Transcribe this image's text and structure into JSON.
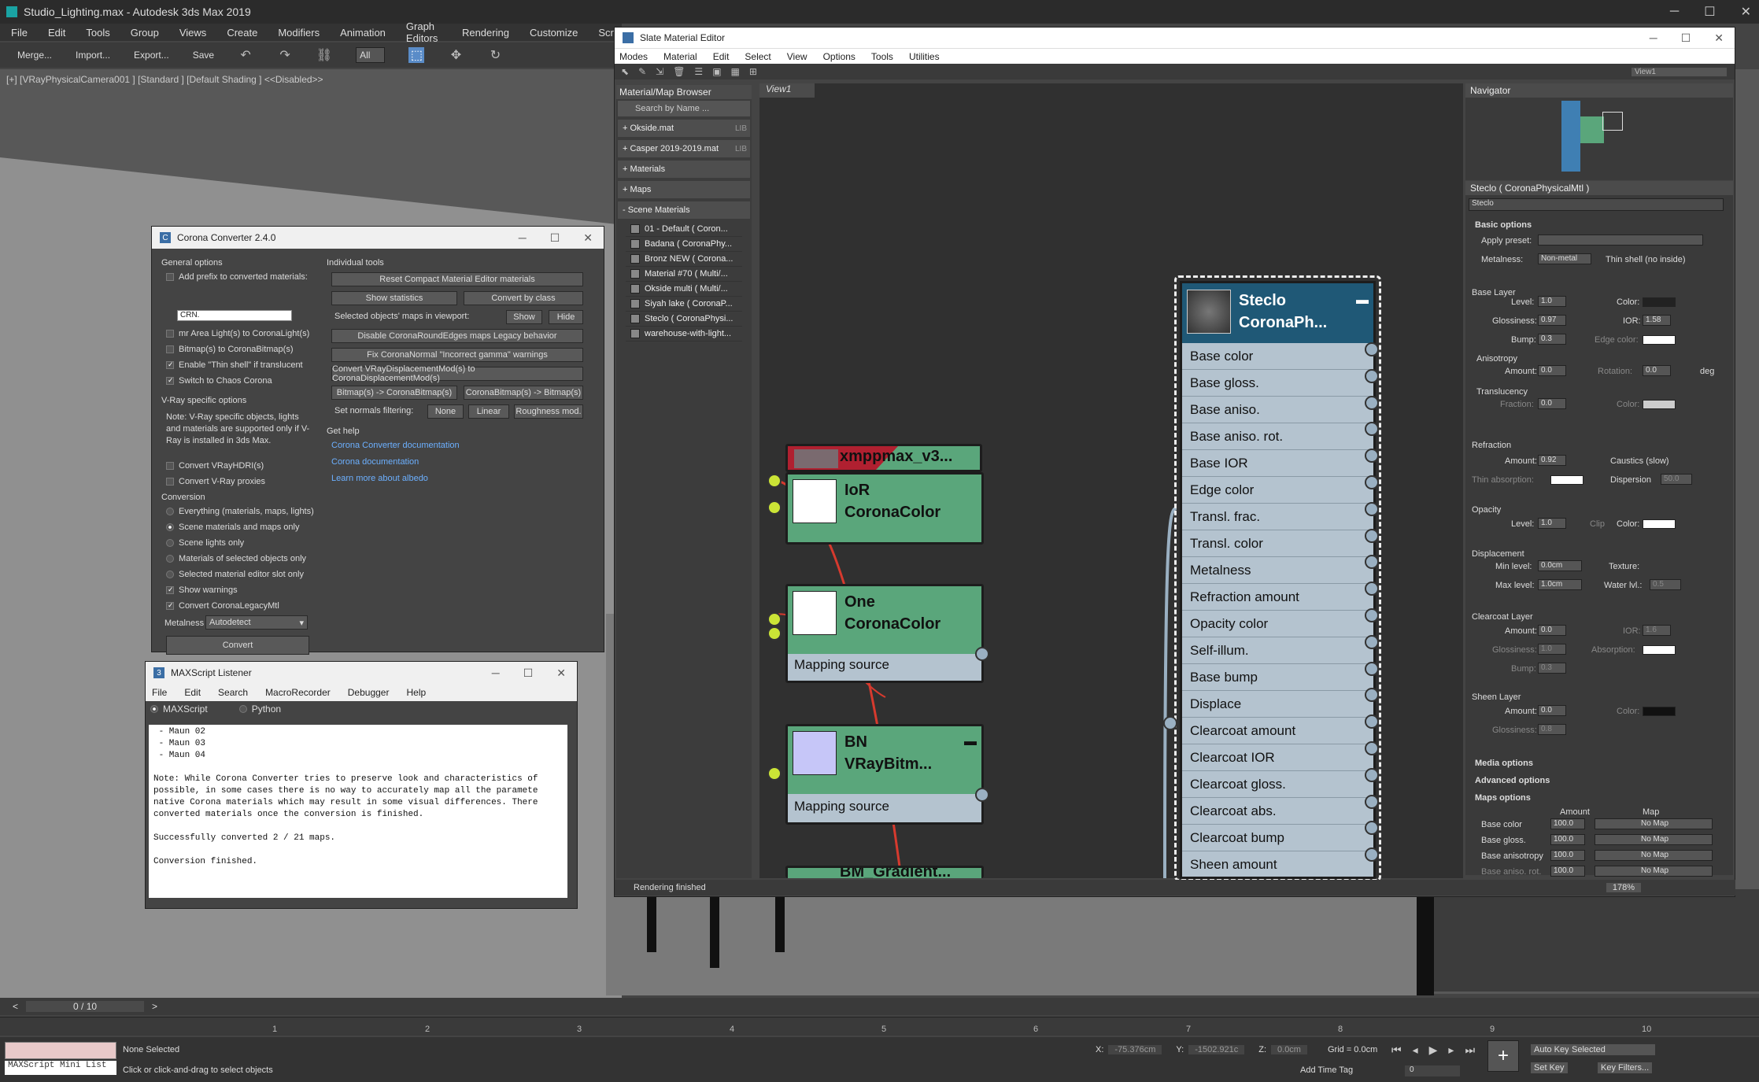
{
  "app": {
    "title": "Studio_Lighting.max - Autodesk 3ds Max 2019",
    "menu": [
      "File",
      "Edit",
      "Tools",
      "Group",
      "Views",
      "Create",
      "Modifiers",
      "Animation",
      "Graph Editors",
      "Rendering",
      "Customize",
      "Scrip"
    ],
    "toolbar": {
      "merge": "Merge...",
      "import": "Import...",
      "export": "Export...",
      "save": "Save",
      "filter": "All"
    },
    "viewport_label": "[+] [VRayPhysicalCamera001 ] [Standard ] [Default Shading ] <<Disabled>>"
  },
  "timeline": {
    "frame": "0 / 10",
    "ticks": [
      "1",
      "2",
      "3",
      "4",
      "5",
      "6",
      "7",
      "8",
      "9",
      "10"
    ]
  },
  "status": {
    "mini_listener": "MAXScript Mini List",
    "selection": "None Selected",
    "prompt": "Click or click-and-drag to select objects",
    "x_label": "X:",
    "x": "-75.376cm",
    "y_label": "Y:",
    "y": "-1502.921c",
    "z_label": "Z:",
    "z": "0.0cm",
    "grid": "Grid = 0.0cm",
    "add_time_tag": "Add Time Tag",
    "auto_key": "Auto Key",
    "set_key": "Set Key",
    "selected": "Selected",
    "key_filters": "Key Filters...",
    "frame_field": "0"
  },
  "converter": {
    "title": "Corona Converter 2.4.0",
    "general": "General options",
    "add_prefix": "Add prefix to converted materials:",
    "prefix_value": "CRN.",
    "opts": [
      {
        "label": "mr Area Light(s) to CoronaLight(s)",
        "on": false
      },
      {
        "label": "Bitmap(s) to CoronaBitmap(s)",
        "on": false
      },
      {
        "label": "Enable \"Thin shell\" if translucent",
        "on": true
      },
      {
        "label": "Switch to Chaos Corona",
        "on": true
      }
    ],
    "vray_head": "V-Ray specific options",
    "vray_note": "Note: V-Ray specific objects, lights and materials are supported only if V-Ray is installed in 3ds Max.",
    "vray_opts": [
      "Convert VRayHDRI(s)",
      "Convert V-Ray proxies"
    ],
    "conv_head": "Conversion",
    "conv_opts": [
      {
        "label": "Everything (materials, maps, lights)",
        "on": false
      },
      {
        "label": "Scene materials and maps only",
        "on": true
      },
      {
        "label": "Scene lights only",
        "on": false
      },
      {
        "label": "Materials of selected objects only",
        "on": false
      },
      {
        "label": "Selected material editor slot only",
        "on": false
      }
    ],
    "show_warnings": "Show warnings",
    "convert_legacy": "Convert CoronaLegacyMtl",
    "metalness_label": "Metalness",
    "metalness_value": "Autodetect",
    "convert_btn": "Convert",
    "tools_head": "Individual tools",
    "reset_btn": "Reset Compact Material Editor materials",
    "show_stats": "Show statistics",
    "convert_class": "Convert by class",
    "sel_maps": "Selected objects' maps in viewport:",
    "show": "Show",
    "hide": "Hide",
    "disable_round": "Disable CoronaRoundEdges maps Legacy behavior",
    "fix_normal": "Fix CoronaNormal \"Incorrect gamma\" warnings",
    "convert_disp": "Convert VRayDisplacementMod(s) to CoronaDisplacementMod(s)",
    "bm_to_cbm": "Bitmap(s) -> CoronaBitmap(s)",
    "cbm_to_bm": "CoronaBitmap(s) -> Bitmap(s)",
    "normals_label": "Set normals filtering:",
    "none": "None",
    "linear": "Linear",
    "rough": "Roughness mod.",
    "help_head": "Get help",
    "links": [
      "Corona Converter documentation",
      "Corona documentation",
      "Learn more about albedo"
    ]
  },
  "listener": {
    "title": "MAXScript Listener",
    "menu": [
      "File",
      "Edit",
      "Search",
      "MacroRecorder",
      "Debugger",
      "Help"
    ],
    "tabs": [
      "MAXScript",
      "Python"
    ],
    "output": " - Maun 02\n - Maun 03\n - Maun 04\n\nNote: While Corona Converter tries to preserve look and characteristics of\npossible, in some cases there is no way to accurately map all the paramete\nnative Corona materials which may result in some visual differences. There\nconverted materials once the conversion is finished.\n\nSuccessfully converted 2 / 21 maps.\n\nConversion finished."
  },
  "slate": {
    "title": "Slate Material Editor",
    "menu": [
      "Modes",
      "Material",
      "Edit",
      "Select",
      "View",
      "Options",
      "Tools",
      "Utilities"
    ],
    "view_dropdown": "View1",
    "browser_title": "Material/Map Browser",
    "search": "Search by Name ...",
    "libs": [
      {
        "name": "+ Okside.mat",
        "tag": "LIB"
      },
      {
        "name": "+ Casper 2019-2019.mat",
        "tag": "LIB"
      },
      {
        "name": "+ Materials",
        "tag": ""
      },
      {
        "name": "+ Maps",
        "tag": ""
      }
    ],
    "scene_head": "- Scene Materials",
    "scene_items": [
      "01 - Default  ( Coron...",
      "Badana  ( CoronaPhy...",
      "Bronz NEW  ( Corona...",
      "Material #70  ( Multi/...",
      "Okside multi  ( Multi/...",
      "Siyah lake  ( CoronaP...",
      "Steclo  ( CoronaPhysi...",
      "warehouse-with-light..."
    ],
    "view_tab": "View1",
    "navigator": "Navigator",
    "status": "Rendering finished",
    "zoom": "178%",
    "nodes": {
      "top": "xmppmax_v3...",
      "ior_line1": "IoR",
      "ior_line2": "CoronaColor",
      "one_line1": "One",
      "one_line2": "CoronaColor",
      "one_sub": "Mapping source",
      "bn_line1": "BN",
      "bn_line2": "VRayBitm...",
      "bn_sub": "Mapping source",
      "bottom": "BM_Gradient...",
      "main_line1": "Steclo",
      "main_line2": "CoronaPh...",
      "slots": [
        "Base color",
        "Base gloss.",
        "Base aniso.",
        "Base aniso. rot.",
        "Base IOR",
        "Edge color",
        "Transl. frac.",
        "Transl. color",
        "Metalness",
        "Refraction amount",
        "Opacity color",
        "Self-illum.",
        "Base bump",
        "Displace",
        "Clearcoat amount",
        "Clearcoat IOR",
        "Clearcoat gloss.",
        "Clearcoat abs.",
        "Clearcoat bump",
        "Sheen amount"
      ]
    }
  },
  "props": {
    "header": "Steclo  ( CoronaPhysicalMtl )",
    "name": "Steclo",
    "basic": "Basic options",
    "apply_preset": "Apply preset:",
    "metalness": "Metalness:",
    "metal_val": "Non-metal",
    "thin_shell": "Thin shell (no inside)",
    "base_layer": "Base Layer",
    "level": "Level:",
    "level_val": "1.0",
    "color": "Color:",
    "gloss": "Glossiness:",
    "gloss_val": "0.97",
    "ior": "IOR:",
    "ior_val": "1.58",
    "bump": "Bump:",
    "bump_val": "0.3",
    "edge_color": "Edge color:",
    "aniso": "Anisotropy",
    "amount": "Amount:",
    "aniso_val": "0.0",
    "rotation": "Rotation:",
    "rot_val": "0.0",
    "deg": "deg",
    "transl": "Translucency",
    "fraction": "Fraction:",
    "frac_val": "0.0",
    "refraction": "Refraction",
    "refr_val": "0.92",
    "caustics": "Caustics (slow)",
    "thin_abs": "Thin absorption:",
    "dispersion": "Dispersion",
    "disp_val": "50.0",
    "opacity": "Opacity",
    "op_level": "1.0",
    "clip": "Clip",
    "displacement": "Displacement",
    "min_level": "Min level:",
    "min_val": "0.0cm",
    "texture": "Texture:",
    "max_level": "Max level:",
    "max_val": "1.0cm",
    "water": "Water lvl.:",
    "water_val": "0.5",
    "clearcoat": "Clearcoat Layer",
    "cc_amount": "0.0",
    "cc_ior": "1.6",
    "cc_gloss": "1.0",
    "absorption": "Absorption:",
    "cc_bump": "0.3",
    "sheen": "Sheen Layer",
    "sh_amount": "0.0",
    "sh_gloss": "0.8",
    "media": "Media options",
    "advanced": "Advanced options",
    "maps": "Maps options",
    "maps_amount": "Amount",
    "maps_map": "Map",
    "map_rows": [
      {
        "name": "Base color",
        "v": "100.0",
        "m": "No Map"
      },
      {
        "name": "Base gloss.",
        "v": "100.0",
        "m": "No Map"
      },
      {
        "name": "Base anisotropy",
        "v": "100.0",
        "m": "No Map"
      },
      {
        "name": "Base aniso. rot.",
        "v": "100.0",
        "m": "No Map"
      }
    ]
  },
  "colors": {
    "node_green": "#5aa67b",
    "node_blue": "#1f5876",
    "slot": "#b4c3cf",
    "link": "#6cb0ff",
    "wire": "#d63a2e"
  }
}
